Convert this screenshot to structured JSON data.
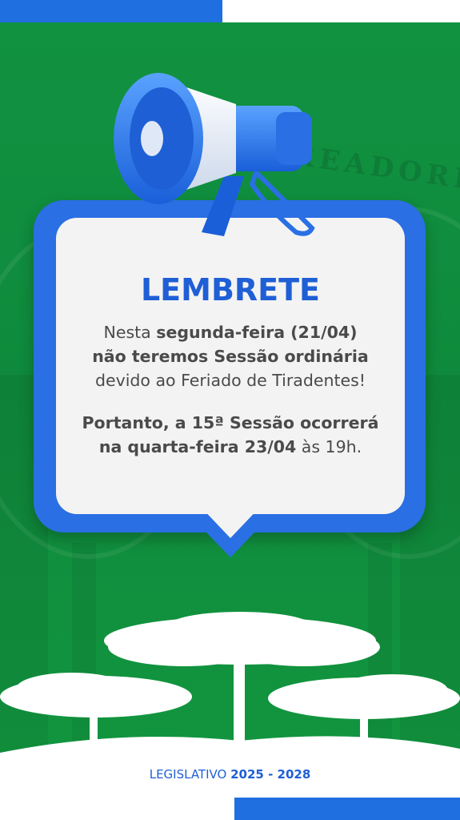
{
  "card": {
    "title": "LEMBRETE",
    "line1_pre": "Nesta ",
    "line1_bold": "segunda-feira (21/04)",
    "line2_bold": "não teremos Sessão ordinária",
    "line3": "devido ao Feriado de Tiradentes!",
    "line4_bold": "Portanto, a 15ª Sessão ocorrerá",
    "line5_bold": "na quarta-feira 23/04",
    "line5_rest": " às 19h."
  },
  "footer": {
    "label": "LEGISLATIVO ",
    "years": "2025 - 2028"
  },
  "background": {
    "faded_text": "VEREADORES"
  },
  "colors": {
    "green": "#119241",
    "blue": "#2a6fe3",
    "text_blue": "#1f5fd6",
    "card_bg": "#f3f3f3"
  },
  "icons": [
    "megaphone-icon",
    "araucaria-trees-graphic"
  ]
}
